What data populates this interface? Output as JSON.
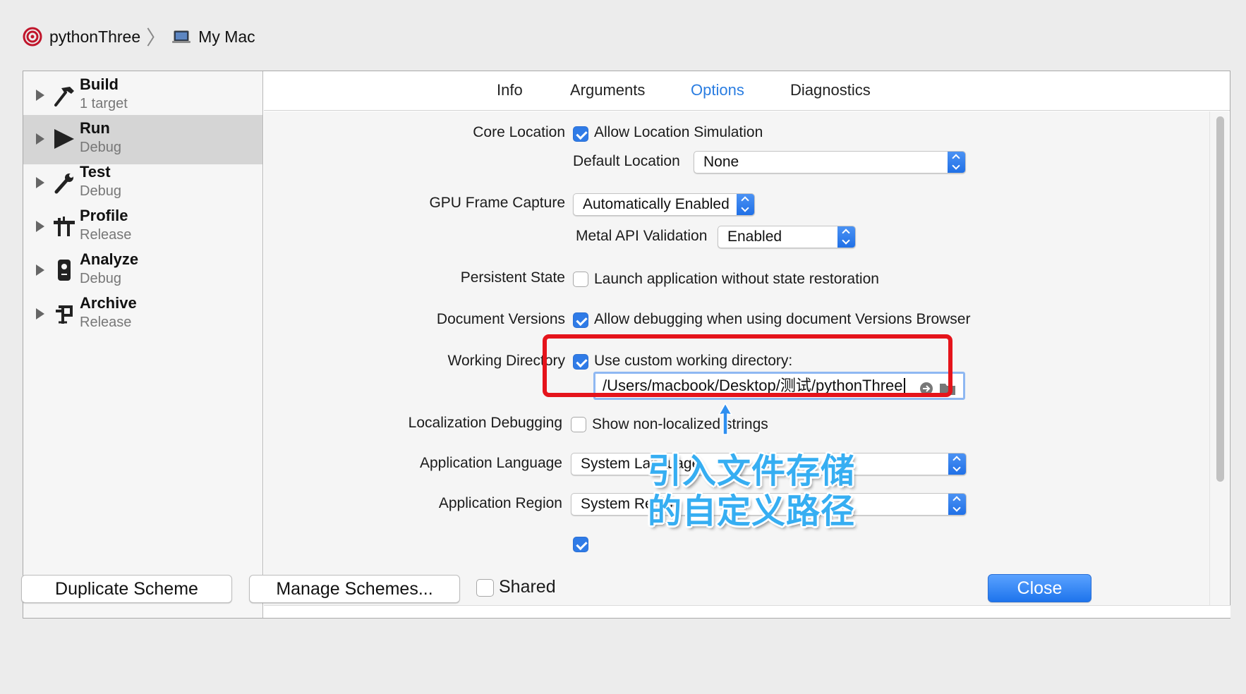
{
  "breadcrumb": {
    "scheme": "pythonThree",
    "destination": "My Mac"
  },
  "actions": [
    {
      "title": "Build",
      "subtitle": "1 target"
    },
    {
      "title": "Run",
      "subtitle": "Debug"
    },
    {
      "title": "Test",
      "subtitle": "Debug"
    },
    {
      "title": "Profile",
      "subtitle": "Release"
    },
    {
      "title": "Analyze",
      "subtitle": "Debug"
    },
    {
      "title": "Archive",
      "subtitle": "Release"
    }
  ],
  "tabs": [
    "Info",
    "Arguments",
    "Options",
    "Diagnostics"
  ],
  "active_tab": "Options",
  "options": {
    "core_location": {
      "label": "Core Location",
      "checkbox": "Allow Location Simulation",
      "checked": true,
      "default_location_label": "Default Location",
      "default_location_value": "None"
    },
    "gpu": {
      "label": "GPU Frame Capture",
      "value": "Automatically Enabled",
      "metal_label": "Metal API Validation",
      "metal_value": "Enabled"
    },
    "persistent_state": {
      "label": "Persistent State",
      "checkbox": "Launch application without state restoration",
      "checked": false
    },
    "document_versions": {
      "label": "Document Versions",
      "checkbox": "Allow debugging when using document Versions Browser",
      "checked": true
    },
    "working_directory": {
      "label": "Working Directory",
      "checkbox": "Use custom working directory:",
      "checked": true,
      "path": "/Users/macbook/Desktop/测试/pythonThree"
    },
    "localization": {
      "label": "Localization Debugging",
      "checkbox": "Show non-localized strings",
      "checked": false
    },
    "app_language": {
      "label": "Application Language",
      "value": "System Language"
    },
    "app_region": {
      "label": "Application Region",
      "value": "System Region"
    }
  },
  "annotation": {
    "line1": "引入文件存储",
    "line2": "的自定义路径"
  },
  "footer": {
    "duplicate": "Duplicate Scheme",
    "manage": "Manage Schemes...",
    "shared": "Shared",
    "shared_checked": false,
    "close": "Close"
  },
  "colors": {
    "accent": "#2a7de1",
    "highlight_box": "#e5141b",
    "annotation": "#36aef2"
  }
}
